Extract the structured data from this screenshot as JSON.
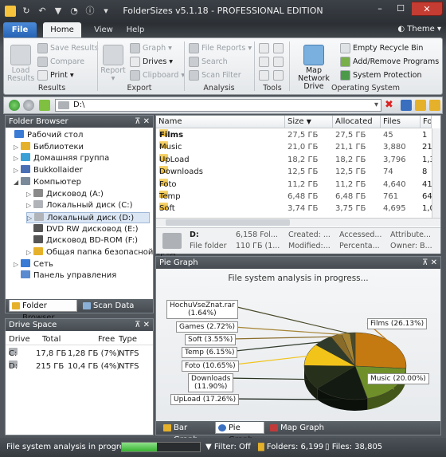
{
  "window": {
    "title": "FolderSizes v5.1.18 - PROFESSIONAL EDITION"
  },
  "ribbon": {
    "tabs": [
      "File",
      "Home",
      "View",
      "Help"
    ],
    "theme_label": "Theme",
    "results": {
      "load_results": "Load Results",
      "save_results": "Save Results",
      "compare": "Compare",
      "print": "Print",
      "label": "Results"
    },
    "export": {
      "report": "Report",
      "graph": "Graph",
      "drives": "Drives",
      "clipboard": "Clipboard",
      "label": "Export"
    },
    "analysis": {
      "file_reports": "File Reports",
      "search": "Search",
      "scan_filter": "Scan Filter",
      "label": "Analysis"
    },
    "tools": {
      "label": "Tools"
    },
    "operating_system": {
      "map_network_drive": "Map Network Drive",
      "empty_recycle_bin": "Empty Recycle Bin",
      "add_remove_programs": "Add/Remove Programs",
      "system_protection": "System Protection",
      "label": "Operating System"
    }
  },
  "address": {
    "path": "D:\\"
  },
  "folder_browser": {
    "title": "Folder Browser",
    "items": [
      {
        "label": "Рабочий стол",
        "color": "#3a7bd5"
      },
      {
        "label": "Библиотеки",
        "color": "#e6b12a"
      },
      {
        "label": "Домашняя группа",
        "color": "#3aa0d5"
      },
      {
        "label": "Bukkollaider",
        "color": "#4a6fb5"
      },
      {
        "label": "Компьютер",
        "color": "#7a8a9a"
      },
      {
        "label": "Дисковод (A:)",
        "color": "#8a8a8a"
      },
      {
        "label": "Локальный диск (C:)",
        "color": "#b0b4b8"
      },
      {
        "label": "Локальный диск (D:)",
        "color": "#b0b4b8"
      },
      {
        "label": "DVD RW дисковод (E:)",
        "color": "#555"
      },
      {
        "label": "Дисковод BD-ROM (F:)",
        "color": "#555"
      },
      {
        "label": "Общая папка безопасной сред",
        "color": "#e6b12a"
      },
      {
        "label": "Сеть",
        "color": "#3a7bd5"
      },
      {
        "label": "Панель управления",
        "color": "#5a8ad0"
      }
    ],
    "tabs": [
      "Folder Browser",
      "Scan Data"
    ]
  },
  "drive_space": {
    "title": "Drive Space",
    "columns": [
      "Drive",
      "Total",
      "Free",
      "Type"
    ],
    "rows": [
      {
        "drive": "C:",
        "total": "17,8 ГБ",
        "free": "1,28 ГБ (7%)",
        "type": "NTFS"
      },
      {
        "drive": "D:",
        "total": "215 ГБ",
        "free": "10,4 ГБ (4%)",
        "type": "NTFS"
      }
    ]
  },
  "file_list": {
    "columns": [
      "Name",
      "Size",
      "Allocated",
      "Files",
      "Fo"
    ],
    "rows": [
      {
        "name": "Films",
        "size": "27,5 ГБ",
        "allocated": "27,5 ГБ",
        "files": "45",
        "fo": "1"
      },
      {
        "name": "Music",
        "size": "21,0 ГБ",
        "allocated": "21,1 ГБ",
        "files": "3,880",
        "fo": "21"
      },
      {
        "name": "UpLoad",
        "size": "18,2 ГБ",
        "allocated": "18,2 ГБ",
        "files": "3,796",
        "fo": "1,3"
      },
      {
        "name": "Downloads",
        "size": "12,5 ГБ",
        "allocated": "12,5 ГБ",
        "files": "74",
        "fo": "8"
      },
      {
        "name": "Foto",
        "size": "11,2 ГБ",
        "allocated": "11,2 ГБ",
        "files": "4,640",
        "fo": "41"
      },
      {
        "name": "Temp",
        "size": "6,48 ГБ",
        "allocated": "6,48 ГБ",
        "files": "761",
        "fo": "64"
      },
      {
        "name": "Soft",
        "size": "3,74 ГБ",
        "allocated": "3,75 ГБ",
        "files": "4,695",
        "fo": "1,0"
      }
    ]
  },
  "details": {
    "name": "D:",
    "type": "File folder",
    "files": "6,158 Fol...",
    "size": "110 ГБ (1...",
    "created": "Created: ...",
    "modified": "Modified:...",
    "accessed": "Accessed...",
    "percent": "Percenta...",
    "attrib": "Attribute...",
    "owner": "Owner: B..."
  },
  "pie_graph": {
    "title": "Pie Graph",
    "status": "File system analysis in progress...",
    "tabs": [
      "Bar Graph",
      "Pie Graph",
      "Map Graph"
    ]
  },
  "chart_data": {
    "type": "pie",
    "title": "",
    "categories": [
      "Films",
      "Music",
      "UpLoad",
      "Downloads",
      "Foto",
      "Temp",
      "Soft",
      "Games",
      "HochuVseZnat.rar"
    ],
    "values": [
      26.13,
      20.0,
      17.26,
      11.9,
      10.65,
      6.15,
      3.55,
      2.72,
      1.64
    ],
    "labels": [
      "Films (26.13%)",
      "Music (20.00%)",
      "UpLoad (17.26%)",
      "Downloads\n(11.90%)",
      "Foto (10.65%)",
      "Temp (6.15%)",
      "Soft (3.55%)",
      "Games (2.72%)",
      "HochuVseZnat.rar\n(1.64%)"
    ],
    "colors": [
      "#c47a10",
      "#6f8f2a",
      "#121a12",
      "#26301a",
      "#f2c319",
      "#2f3a2a",
      "#8a6c2a",
      "#a68434",
      "#4a4a2a"
    ],
    "start_angle_deg": -90
  },
  "statusbar": {
    "message": "File system analysis in progress...",
    "progress": 0.45,
    "filter": "Filter: Off",
    "folders": "Folders: 6,199",
    "files": "Files: 38,805"
  }
}
